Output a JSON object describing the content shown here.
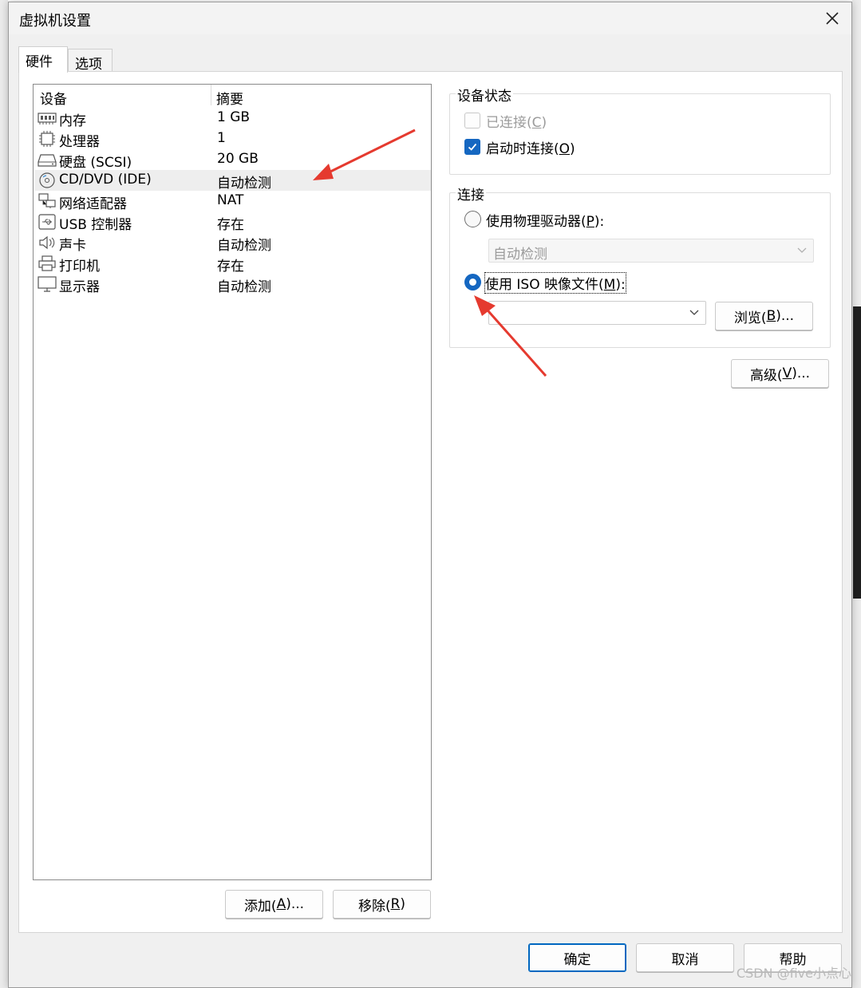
{
  "dialog": {
    "title": "虚拟机设置",
    "tabs": [
      {
        "label": "硬件",
        "active": true
      },
      {
        "label": "选项",
        "active": false
      }
    ]
  },
  "device_list": {
    "columns": [
      "设备",
      "摘要"
    ],
    "rows": [
      {
        "icon": "memory-icon",
        "device": "内存",
        "summary": "1 GB",
        "selected": false
      },
      {
        "icon": "processor-icon",
        "device": "处理器",
        "summary": "1",
        "selected": false
      },
      {
        "icon": "hard-disk-icon",
        "device": "硬盘 (SCSI)",
        "summary": "20 GB",
        "selected": false
      },
      {
        "icon": "cd-dvd-icon",
        "device": "CD/DVD (IDE)",
        "summary": "自动检测",
        "selected": true
      },
      {
        "icon": "network-adapter-icon",
        "device": "网络适配器",
        "summary": "NAT",
        "selected": false
      },
      {
        "icon": "usb-icon",
        "device": "USB 控制器",
        "summary": "存在",
        "selected": false
      },
      {
        "icon": "sound-icon",
        "device": "声卡",
        "summary": "自动检测",
        "selected": false
      },
      {
        "icon": "printer-icon",
        "device": "打印机",
        "summary": "存在",
        "selected": false
      },
      {
        "icon": "display-icon",
        "device": "显示器",
        "summary": "自动检测",
        "selected": false
      }
    ]
  },
  "list_buttons": {
    "add": {
      "text": "添加(",
      "key": "A",
      "tail": ")..."
    },
    "remove": {
      "text": "移除(",
      "key": "R",
      "tail": ")"
    }
  },
  "device_status": {
    "label": "设备状态",
    "connected": {
      "text": "已连接(",
      "key": "C",
      "tail": ")",
      "checked": false,
      "enabled": false
    },
    "connect_at_power_on": {
      "text": "启动时连接(",
      "key": "O",
      "tail": ")",
      "checked": true,
      "enabled": true
    }
  },
  "connection": {
    "label": "连接",
    "physical": {
      "text": "使用物理驱动器(",
      "key": "P",
      "tail": "):",
      "selected": false
    },
    "physical_select_value": "自动检测",
    "iso": {
      "text": "使用 ISO 映像文件(",
      "key": "M",
      "tail": "):",
      "selected": true
    },
    "iso_path": "",
    "browse": {
      "text": "浏览(",
      "key": "B",
      "tail": ")..."
    }
  },
  "advanced": {
    "text": "高级(",
    "key": "V",
    "tail": ")..."
  },
  "footer": {
    "ok": "确定",
    "cancel": "取消",
    "help": "帮助"
  },
  "watermark": "CSDN @five小点心",
  "colors": {
    "accent": "#1567c1",
    "annotation_arrow": "#e53a2f"
  }
}
